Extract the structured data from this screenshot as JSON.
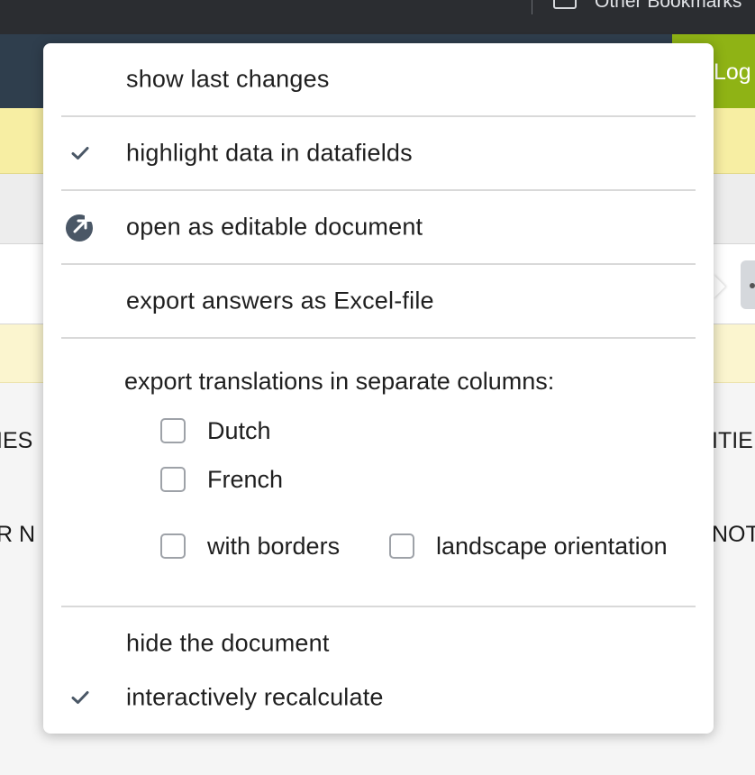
{
  "browser": {
    "bookmarks_label": "Other Bookmarks"
  },
  "app": {
    "logout_label": "Log out",
    "bg_texts": [
      "IES",
      "ITIE",
      "R N",
      "NOT"
    ]
  },
  "menu": {
    "items": [
      {
        "label": "show last changes",
        "icon": "none"
      },
      {
        "label": "highlight data in datafields",
        "icon": "checkmark-icon",
        "checked": true
      },
      {
        "label": "open as editable document",
        "icon": "open-external-icon"
      },
      {
        "label": "export answers as Excel-file",
        "icon": "none"
      }
    ],
    "export_translations": {
      "title": "export translations in separate columns:",
      "languages": [
        {
          "label": "Dutch",
          "checked": false
        },
        {
          "label": "French",
          "checked": false
        }
      ],
      "options": [
        {
          "label": "with borders",
          "checked": false
        },
        {
          "label": "landscape orientation",
          "checked": false
        }
      ]
    },
    "bottom_items": [
      {
        "label": "hide the document",
        "icon": "none"
      },
      {
        "label": "interactively recalculate",
        "icon": "checkmark-icon",
        "checked": true
      }
    ]
  },
  "colors": {
    "header_bg": "#2f3e4d",
    "logout_bg": "#8fb315",
    "icon_color": "#4a5766",
    "highlight_band": "#f7eea3"
  }
}
